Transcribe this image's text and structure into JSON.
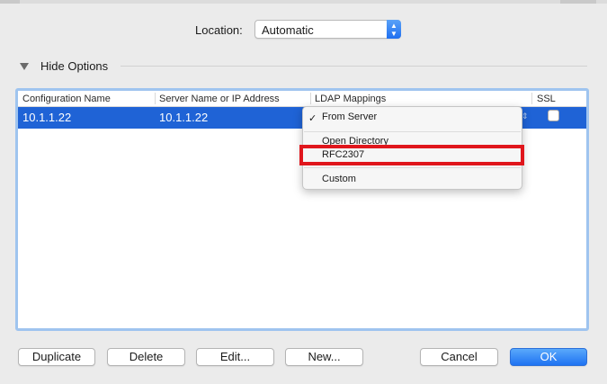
{
  "location": {
    "label": "Location:",
    "value": "Automatic"
  },
  "options": {
    "toggle_label": "Hide Options"
  },
  "table": {
    "columns": [
      "Configuration Name",
      "Server Name or IP Address",
      "LDAP Mappings",
      "SSL"
    ],
    "rows": [
      {
        "config_name": "10.1.1.22",
        "server": "10.1.1.22",
        "ldap_mapping": "From Server",
        "ssl": false
      }
    ]
  },
  "ldap_menu": {
    "items": [
      {
        "label": "From Server",
        "checked": true
      },
      {
        "label": "Open Directory",
        "checked": false
      },
      {
        "label": "RFC2307",
        "checked": false,
        "highlighted": true
      },
      {
        "label": "Custom",
        "checked": false
      }
    ],
    "checkmark": "✓"
  },
  "buttons": {
    "duplicate": "Duplicate",
    "delete": "Delete",
    "edit": "Edit...",
    "new": "New...",
    "cancel": "Cancel",
    "ok": "OK"
  },
  "colors": {
    "selection": "#1f63d6",
    "accent": "#1e72f2",
    "annotation_red": "#e0161c"
  }
}
